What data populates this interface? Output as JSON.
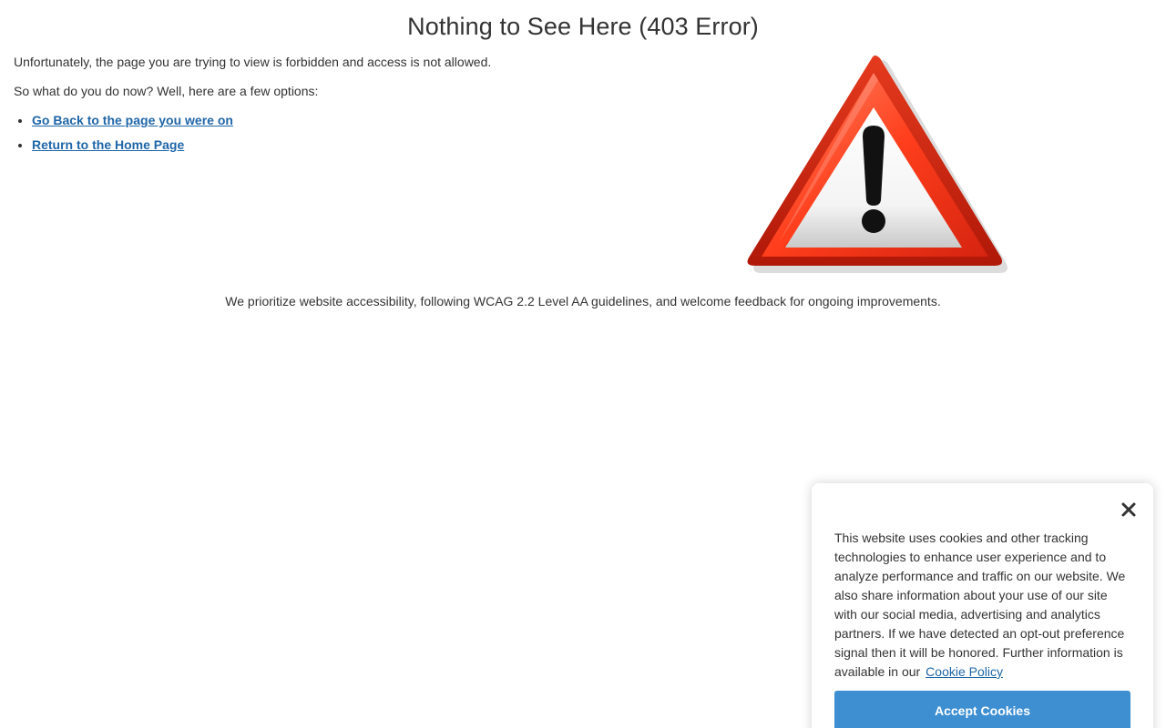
{
  "page": {
    "title": "Nothing to See Here (403 Error)",
    "intro": "Unfortunately, the page you are trying to view is forbidden and access is not allowed.",
    "options_prompt": "So what do you do now? Well, here are a few options:",
    "options": [
      {
        "label": "Go Back to the page you were on"
      },
      {
        "label": "Return to the Home Page"
      }
    ],
    "accessibility_note": "We prioritize website accessibility, following WCAG 2.2 Level AA guidelines, and welcome feedback for ongoing improvements."
  },
  "graphic": {
    "icon": "warning-triangle-icon",
    "colors": {
      "outer": "#c81e0c",
      "inner_light": "#ff5a3c",
      "center": "#ffffff",
      "exclamation": "#111111"
    }
  },
  "cookie_banner": {
    "text": "This website uses cookies and other tracking technologies to enhance user experience and to analyze performance and traffic on our website. We also share information about your use of our site with our social media, advertising and analytics partners. If we have detected an opt-out preference signal then it will be honored. Further information is available in our",
    "link_label": "Cookie Policy",
    "accept_label": "Accept Cookies",
    "close_icon": "close-icon",
    "accent_color": "#3d8fd1",
    "link_color": "#1f66a8"
  }
}
